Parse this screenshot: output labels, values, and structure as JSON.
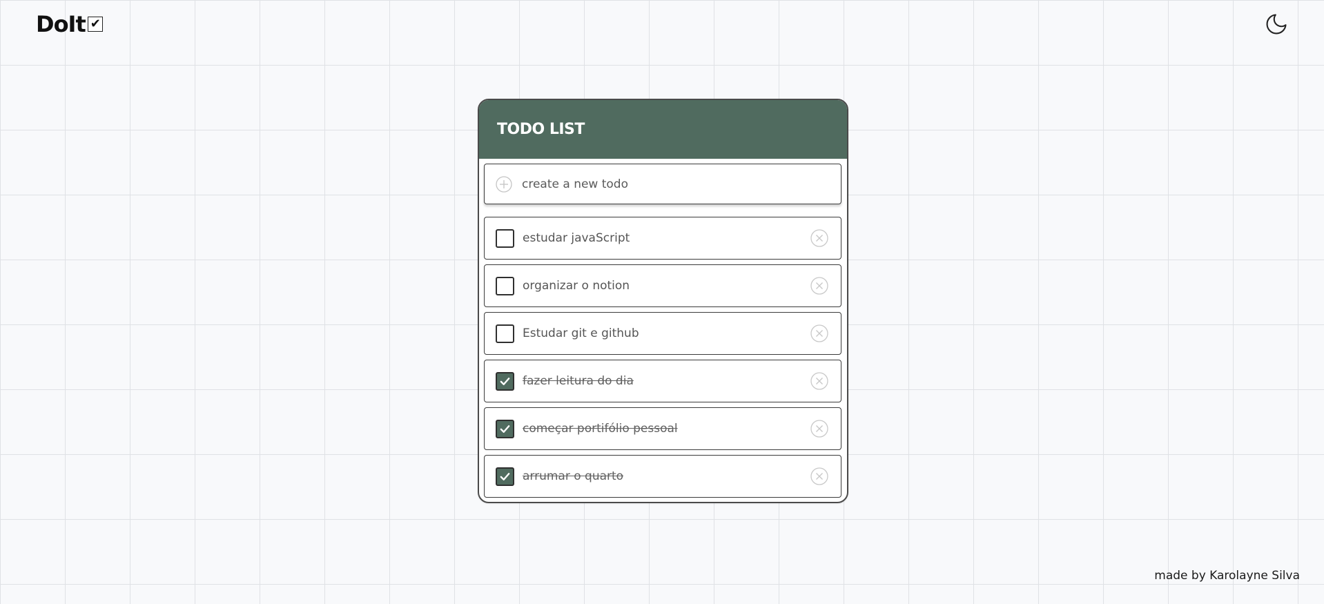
{
  "header": {
    "logo_text": "DoIt",
    "logo_check": "✔",
    "theme_icon": "moon-icon"
  },
  "card": {
    "title": "TODO LIST",
    "accent_color": "#506b5f",
    "new_todo": {
      "placeholder": "create a new todo",
      "value": "",
      "icon": "plus-circle-icon"
    },
    "todos": [
      {
        "text": "estudar javaScript",
        "completed": false
      },
      {
        "text": "organizar o notion",
        "completed": false
      },
      {
        "text": "Estudar git e github",
        "completed": false
      },
      {
        "text": "fazer leitura do dia",
        "completed": true
      },
      {
        "text": "começar portifólio pessoal",
        "completed": true
      },
      {
        "text": "arrumar o quarto",
        "completed": true
      }
    ],
    "delete_icon": "close-circle-icon"
  },
  "footer": {
    "credit": "made by Karolayne Silva"
  }
}
